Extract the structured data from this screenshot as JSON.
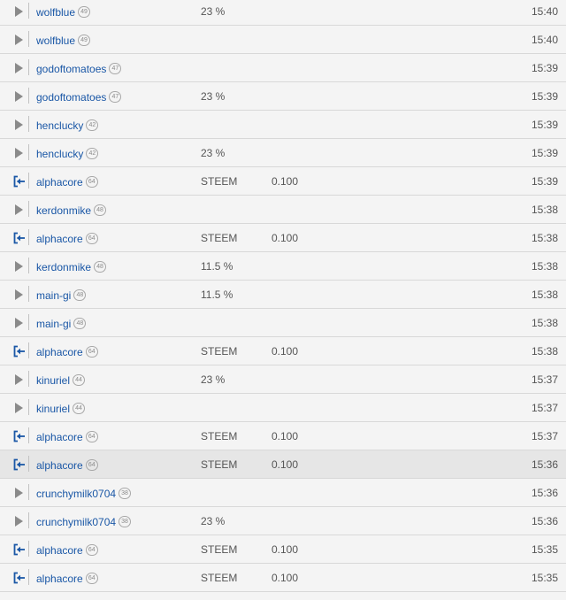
{
  "rows": [
    {
      "type": "vote",
      "icon": "play-triangle-icon",
      "user": "wolfblue",
      "rep": "49",
      "weight": "23 %",
      "asset": "",
      "amount": "",
      "time": "15:40"
    },
    {
      "type": "vote",
      "icon": "play-triangle-icon",
      "user": "wolfblue",
      "rep": "49",
      "weight": "",
      "asset": "",
      "amount": "",
      "time": "15:40"
    },
    {
      "type": "vote",
      "icon": "play-triangle-icon",
      "user": "godoftomatoes",
      "rep": "47",
      "weight": "",
      "asset": "",
      "amount": "",
      "time": "15:39"
    },
    {
      "type": "vote",
      "icon": "play-triangle-icon",
      "user": "godoftomatoes",
      "rep": "47",
      "weight": "23 %",
      "asset": "",
      "amount": "",
      "time": "15:39"
    },
    {
      "type": "vote",
      "icon": "play-triangle-icon",
      "user": "henclucky",
      "rep": "42",
      "weight": "",
      "asset": "",
      "amount": "",
      "time": "15:39"
    },
    {
      "type": "vote",
      "icon": "play-triangle-icon",
      "user": "henclucky",
      "rep": "42",
      "weight": "23 %",
      "asset": "",
      "amount": "",
      "time": "15:39"
    },
    {
      "type": "transfer",
      "icon": "sign-in-arrow-icon",
      "user": "alphacore",
      "rep": "64",
      "weight": "STEEM",
      "asset": "",
      "amount": "0.100",
      "time": "15:39"
    },
    {
      "type": "vote",
      "icon": "play-triangle-icon",
      "user": "kerdonmike",
      "rep": "48",
      "weight": "",
      "asset": "",
      "amount": "",
      "time": "15:38"
    },
    {
      "type": "transfer",
      "icon": "sign-in-arrow-icon",
      "user": "alphacore",
      "rep": "64",
      "weight": "STEEM",
      "asset": "",
      "amount": "0.100",
      "time": "15:38"
    },
    {
      "type": "vote",
      "icon": "play-triangle-icon",
      "user": "kerdonmike",
      "rep": "48",
      "weight": "11.5 %",
      "asset": "",
      "amount": "",
      "time": "15:38"
    },
    {
      "type": "vote",
      "icon": "play-triangle-icon",
      "user": "main-gi",
      "rep": "48",
      "weight": "11.5 %",
      "asset": "",
      "amount": "",
      "time": "15:38"
    },
    {
      "type": "vote",
      "icon": "play-triangle-icon",
      "user": "main-gi",
      "rep": "48",
      "weight": "",
      "asset": "",
      "amount": "",
      "time": "15:38"
    },
    {
      "type": "transfer",
      "icon": "sign-in-arrow-icon",
      "user": "alphacore",
      "rep": "64",
      "weight": "STEEM",
      "asset": "",
      "amount": "0.100",
      "time": "15:38"
    },
    {
      "type": "vote",
      "icon": "play-triangle-icon",
      "user": "kinuriel",
      "rep": "44",
      "weight": "23 %",
      "asset": "",
      "amount": "",
      "time": "15:37"
    },
    {
      "type": "vote",
      "icon": "play-triangle-icon",
      "user": "kinuriel",
      "rep": "44",
      "weight": "",
      "asset": "",
      "amount": "",
      "time": "15:37"
    },
    {
      "type": "transfer",
      "icon": "sign-in-arrow-icon",
      "user": "alphacore",
      "rep": "64",
      "weight": "STEEM",
      "asset": "",
      "amount": "0.100",
      "time": "15:37"
    },
    {
      "type": "transfer",
      "icon": "sign-in-arrow-icon",
      "user": "alphacore",
      "rep": "64",
      "weight": "STEEM",
      "asset": "",
      "amount": "0.100",
      "time": "15:36",
      "highlight": true
    },
    {
      "type": "vote",
      "icon": "play-triangle-icon",
      "user": "crunchymilk0704",
      "rep": "38",
      "weight": "",
      "asset": "",
      "amount": "",
      "time": "15:36"
    },
    {
      "type": "vote",
      "icon": "play-triangle-icon",
      "user": "crunchymilk0704",
      "rep": "38",
      "weight": "23 %",
      "asset": "",
      "amount": "",
      "time": "15:36"
    },
    {
      "type": "transfer",
      "icon": "sign-in-arrow-icon",
      "user": "alphacore",
      "rep": "64",
      "weight": "STEEM",
      "asset": "",
      "amount": "0.100",
      "time": "15:35"
    },
    {
      "type": "transfer",
      "icon": "sign-in-arrow-icon",
      "user": "alphacore",
      "rep": "64",
      "weight": "STEEM",
      "asset": "",
      "amount": "0.100",
      "time": "15:35"
    }
  ],
  "colors": {
    "link": "#1a57a6",
    "vote_icon": "#8a8a8a",
    "transfer_icon": "#1a57a6",
    "row_bg": "#f4f4f4",
    "row_highlight_bg": "#e6e6e6",
    "separator": "#d8d8d8"
  }
}
